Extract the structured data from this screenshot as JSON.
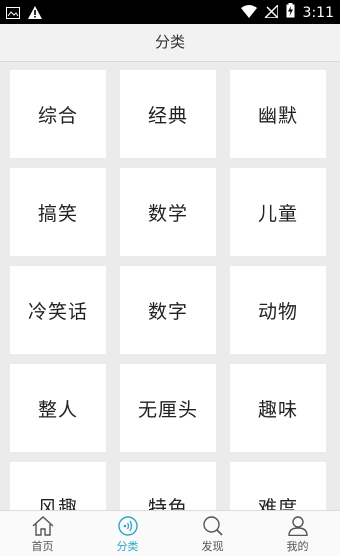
{
  "status_bar": {
    "time": "3:11",
    "icons": [
      "image-notification-icon",
      "warning-icon",
      "wifi-icon",
      "no-signal-icon",
      "battery-charging-icon"
    ]
  },
  "header": {
    "title": "分类"
  },
  "categories": [
    "综合",
    "经典",
    "幽默",
    "搞笑",
    "数学",
    "儿童",
    "冷笑话",
    "数字",
    "动物",
    "整人",
    "无厘头",
    "趣味",
    "风趣",
    "特色",
    "难度"
  ],
  "bottom_nav": {
    "items": [
      {
        "label": "首页",
        "icon": "home-icon",
        "active": false
      },
      {
        "label": "分类",
        "icon": "category-signal-icon",
        "active": true
      },
      {
        "label": "发现",
        "icon": "search-icon",
        "active": false
      },
      {
        "label": "我的",
        "icon": "user-icon",
        "active": false
      }
    ]
  },
  "colors": {
    "accent": "#2aa7c9",
    "background": "#ebebeb",
    "card": "#ffffff",
    "status_bar": "#000000"
  }
}
